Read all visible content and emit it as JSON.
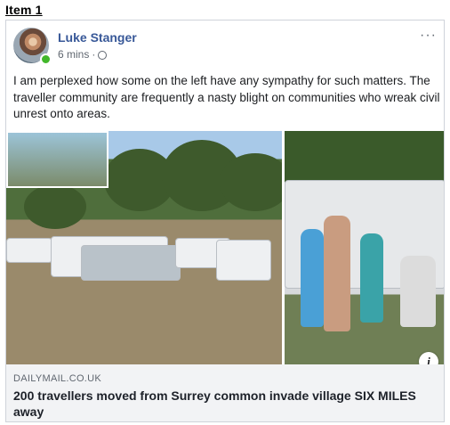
{
  "item_label": "Item 1",
  "post": {
    "author": "Luke Stanger",
    "time": "6 mins",
    "separator": "·",
    "more": "···",
    "text": "I am perplexed how some on the left have any sympathy for such matters. The traveller community are frequently a nasty blight on communities who wreak civil unrest onto areas."
  },
  "link": {
    "domain": "DAILYMAIL.CO.UK",
    "headline": "200 travellers moved from Surrey common invade village SIX MILES away",
    "info": "i"
  },
  "icons": {
    "privacy": "globe-icon",
    "status": "online-dot",
    "menu": "more-options-icon",
    "info": "info-icon"
  },
  "colors": {
    "author": "#385898",
    "online": "#42b72a",
    "footer_bg": "#f2f3f5"
  }
}
